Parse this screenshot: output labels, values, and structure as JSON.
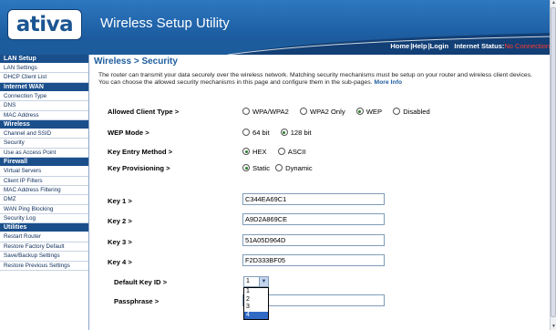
{
  "header": {
    "logo": "ativa",
    "title": "Wireless Setup Utility",
    "links": {
      "home": "Home",
      "help": "Help",
      "login": "Login"
    },
    "status_label": "Internet Status:",
    "status_value": "No Connection",
    "colors": {
      "bar": "#1d5c9c",
      "status": "#ff3b30"
    }
  },
  "sidebar": {
    "sections": [
      {
        "title": "LAN Setup",
        "items": [
          "LAN Settings",
          "DHCP Client List"
        ]
      },
      {
        "title": "Internet WAN",
        "items": [
          "Connection Type",
          "DNS",
          "MAC Address"
        ]
      },
      {
        "title": "Wireless",
        "items": [
          "Channel and SSID",
          "Security",
          "Use as Access Point"
        ]
      },
      {
        "title": "Firewall",
        "items": [
          "Virtual Servers",
          "Client IP Filters",
          "MAC Address Filtering",
          "DMZ",
          "WAN Ping Blocking",
          "Security Log"
        ]
      },
      {
        "title": "Utilities",
        "items": [
          "Restart Router",
          "Restore Factory Default",
          "Save/Backup Settings",
          "Restore Previous Settings"
        ]
      }
    ]
  },
  "main": {
    "title": "Wireless > Security",
    "intro": "The router can transmit your data securely over the wireless network. Matching security mechanisms must be setup on your router and wireless client devices. You can choose the allowed security mechanisms in this page and configure them in the sub-pages.",
    "more_info": "More Info",
    "allowed_client_type": {
      "label": "Allowed Client Type >",
      "options": [
        "WPA/WPA2",
        "WPA2 Only",
        "WEP",
        "Disabled"
      ],
      "selected": "WEP"
    },
    "wep_mode": {
      "label": "WEP Mode >",
      "options": [
        "64 bit",
        "128 bit"
      ],
      "selected": "128 bit"
    },
    "key_entry_method": {
      "label": "Key Entry Method >",
      "options": [
        "HEX",
        "ASCII"
      ],
      "selected": "HEX"
    },
    "key_provisioning": {
      "label": "Key Provisioning >",
      "options": [
        "Static",
        "Dynamic"
      ],
      "selected": "Static"
    },
    "keys": [
      {
        "label": "Key 1 >",
        "value": "C344EA69C1"
      },
      {
        "label": "Key 2 >",
        "value": "A9D2A869CE"
      },
      {
        "label": "Key 3 >",
        "value": "51A05D964D"
      },
      {
        "label": "Key 4 >",
        "value": "F2D333BF05"
      }
    ],
    "default_key_id": {
      "label": "Default Key ID >",
      "value": "1",
      "options": [
        "1",
        "2",
        "3",
        "4"
      ],
      "highlighted": "4"
    },
    "passphrase": {
      "label": "Passphrase >",
      "value": ""
    }
  }
}
